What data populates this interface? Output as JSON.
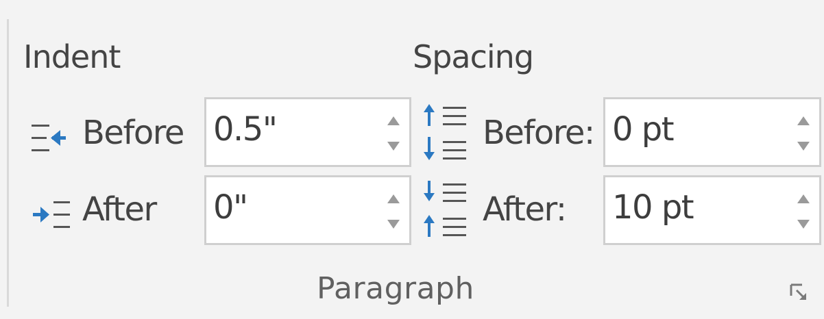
{
  "paragraph_group": {
    "label": "Paragraph",
    "indent": {
      "title": "Indent",
      "before": {
        "label": "Before",
        "value": "0.5\""
      },
      "after": {
        "label": "After",
        "value": "0\""
      }
    },
    "spacing": {
      "title": "Spacing",
      "before": {
        "label": "Before:",
        "value": "0 pt"
      },
      "after": {
        "label": "After:",
        "value": "10 pt"
      }
    }
  },
  "colors": {
    "accent_blue": "#2b79c2",
    "text": "#444444",
    "field_border": "#cfcfcf"
  },
  "icons": [
    "indent-left-icon",
    "indent-right-icon",
    "spacing-before-icon",
    "spacing-after-icon",
    "spin-up-icon",
    "spin-down-icon",
    "dialog-launcher-icon"
  ]
}
